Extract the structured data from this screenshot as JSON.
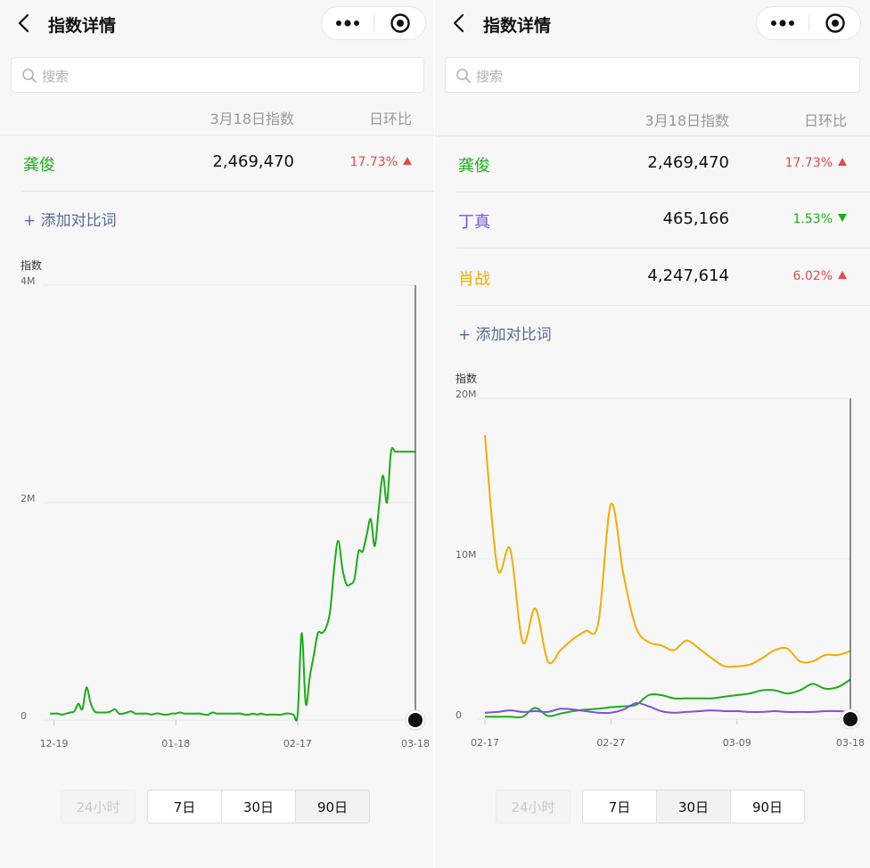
{
  "panels": [
    {
      "nav": {
        "title": "指数详情"
      },
      "search": {
        "placeholder": "搜索"
      },
      "header": {
        "date_label": "3月18日指数",
        "ratio_label": "日环比"
      },
      "rows": [
        {
          "keyword": "龚俊",
          "value": "2,469,470",
          "ratio": "17.73%",
          "direction": "up",
          "color": "#1aad19"
        }
      ],
      "add_label": "+ 添加对比词",
      "tabs": [
        {
          "label": "24小时",
          "state": "disabled"
        },
        {
          "label": "7日",
          "state": "normal"
        },
        {
          "label": "30日",
          "state": "normal"
        },
        {
          "label": "90日",
          "state": "active"
        }
      ],
      "chart_data": {
        "type": "line",
        "ylabel": "指数",
        "ylim": [
          0,
          4000000
        ],
        "yticks": [
          {
            "value": 0,
            "label": "0"
          },
          {
            "value": 2000000,
            "label": "2M"
          },
          {
            "value": 4000000,
            "label": "4M"
          }
        ],
        "xticks": [
          {
            "index": 1,
            "label": "12-19"
          },
          {
            "index": 31,
            "label": "01-18"
          },
          {
            "index": 61,
            "label": "02-17"
          },
          {
            "index": 90,
            "label": "03-18"
          }
        ],
        "x_count": 91,
        "series": [
          {
            "color": "#1aad19",
            "values": [
              60000,
              60000,
              60000,
              50000,
              60000,
              70000,
              80000,
              150000,
              100000,
              300000,
              160000,
              80000,
              70000,
              70000,
              70000,
              80000,
              100000,
              60000,
              60000,
              70000,
              80000,
              60000,
              60000,
              60000,
              60000,
              50000,
              60000,
              60000,
              50000,
              50000,
              60000,
              60000,
              70000,
              60000,
              60000,
              60000,
              60000,
              60000,
              50000,
              50000,
              70000,
              60000,
              60000,
              60000,
              60000,
              60000,
              60000,
              60000,
              50000,
              50000,
              60000,
              50000,
              60000,
              50000,
              50000,
              50000,
              50000,
              50000,
              60000,
              60000,
              50000,
              50000,
              800000,
              150000,
              400000,
              600000,
              800000,
              800000,
              850000,
              1000000,
              1400000,
              1650000,
              1400000,
              1250000,
              1250000,
              1300000,
              1550000,
              1550000,
              1700000,
              1850000,
              1600000,
              1950000,
              2250000,
              2000000,
              2469470,
              2469470,
              2469470,
              2469470,
              2469470,
              2469470,
              2469470
            ]
          }
        ]
      }
    },
    {
      "nav": {
        "title": "指数详情"
      },
      "search": {
        "placeholder": "搜索"
      },
      "header": {
        "date_label": "3月18日指数",
        "ratio_label": "日环比"
      },
      "rows": [
        {
          "keyword": "龚俊",
          "value": "2,469,470",
          "ratio": "17.73%",
          "direction": "up",
          "color": "#1aad19"
        },
        {
          "keyword": "丁真",
          "value": "465,166",
          "ratio": "1.53%",
          "direction": "down",
          "color": "#7b52db"
        },
        {
          "keyword": "肖战",
          "value": "4,247,614",
          "ratio": "6.02%",
          "direction": "up",
          "color": "#f0ad00"
        }
      ],
      "add_label": "+ 添加对比词",
      "tabs": [
        {
          "label": "24小时",
          "state": "disabled"
        },
        {
          "label": "7日",
          "state": "normal"
        },
        {
          "label": "30日",
          "state": "active"
        },
        {
          "label": "90日",
          "state": "normal"
        }
      ],
      "chart_data": {
        "type": "line",
        "ylabel": "指数",
        "ylim": [
          0,
          20000000
        ],
        "yticks": [
          {
            "value": 0,
            "label": "0"
          },
          {
            "value": 10000000,
            "label": "10M"
          },
          {
            "value": 20000000,
            "label": "20M"
          }
        ],
        "xticks": [
          {
            "index": 0,
            "label": "02-17"
          },
          {
            "index": 10,
            "label": "02-27"
          },
          {
            "index": 20,
            "label": "03-09"
          },
          {
            "index": 29,
            "label": "03-18"
          }
        ],
        "x_count": 30,
        "series": [
          {
            "color": "#f0ad00",
            "values": [
              17700000,
              9400000,
              10600000,
              4800000,
              6900000,
              3600000,
              4300000,
              5000000,
              5500000,
              6000000,
              13400000,
              9000000,
              5700000,
              4800000,
              4600000,
              4300000,
              4900000,
              4400000,
              3800000,
              3300000,
              3300000,
              3400000,
              3800000,
              4300000,
              4400000,
              3600000,
              3600000,
              4000000,
              4000000,
              4247614
            ]
          },
          {
            "color": "#1aad19",
            "values": [
              150000,
              150000,
              150000,
              150000,
              700000,
              200000,
              350000,
              500000,
              600000,
              650000,
              750000,
              800000,
              900000,
              1500000,
              1500000,
              1300000,
              1300000,
              1300000,
              1300000,
              1400000,
              1500000,
              1600000,
              1800000,
              1800000,
              1600000,
              1800000,
              2200000,
              1900000,
              2000000,
              2469470
            ]
          },
          {
            "color": "#7b52db",
            "values": [
              400000,
              450000,
              550000,
              450000,
              500000,
              450000,
              650000,
              600000,
              500000,
              400000,
              400000,
              600000,
              1000000,
              800000,
              500000,
              400000,
              450000,
              500000,
              550000,
              500000,
              500000,
              450000,
              450000,
              500000,
              450000,
              450000,
              450000,
              500000,
              500000,
              465166
            ]
          }
        ]
      }
    }
  ]
}
